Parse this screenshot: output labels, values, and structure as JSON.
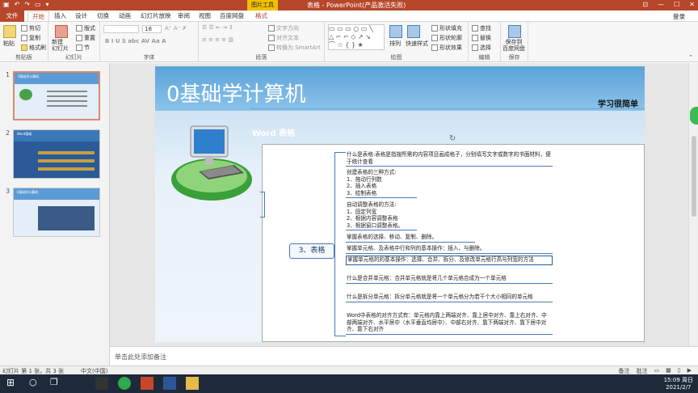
{
  "window": {
    "title": "表格 - PowerPoint(产品激活失败)",
    "context_tab": "图片工具",
    "login": "登录"
  },
  "tabs": [
    "文件",
    "开始",
    "插入",
    "设计",
    "切换",
    "动画",
    "幻灯片放映",
    "审阅",
    "视图",
    "百度网盘",
    "格式"
  ],
  "ribbon": {
    "clipboard": {
      "paste": "粘贴",
      "cut": "剪切",
      "copy": "复制",
      "format_painter": "格式刷",
      "label": "剪贴板"
    },
    "slides": {
      "new_slide": "新建\n幻灯片",
      "layout": "版式",
      "reset": "重置",
      "section": "节",
      "label": "幻灯片"
    },
    "font": {
      "size": "18",
      "label": "字体"
    },
    "paragraph": {
      "text_direction": "文字方向",
      "align_text": "对齐文本",
      "smartart": "转换为 SmartArt",
      "label": "段落"
    },
    "drawing": {
      "arrange": "排列",
      "quick_styles": "快速样式",
      "fill": "形状填充",
      "outline": "形状轮廓",
      "effects": "形状效果",
      "label": "绘图"
    },
    "editing": {
      "find": "查找",
      "replace": "替换",
      "select": "选择",
      "label": "编辑"
    },
    "save": {
      "save_baidu": "保存到\n百度网盘",
      "label": "保存"
    }
  },
  "slides_panel": [
    {
      "num": "1",
      "caption": "0基础学计算机"
    },
    {
      "num": "2",
      "caption": "Word基础"
    },
    {
      "num": "3",
      "caption": "0基础学计算机"
    }
  ],
  "slide": {
    "title": "0基础学计算机",
    "subtitle": "学习很简单",
    "word_title": "Word 表格",
    "node": "3、表格",
    "leaves": [
      "什么是表格:表格是指按所需的内容项目画成格子，分别填写文字或数字的书面材料，便于统计查看",
      "创建表格的三种方式:\n1、拖动行列数\n2、插入表格\n3、绘制表格",
      "自动调整表格的方法:\n1、固定列宽\n2、根据内容调整表格\n3、根据窗口调整表格。",
      "掌握表格的选择、移动、复制、删除。",
      "掌握单元格、及表格中行和列的基本操作：插入、与删除。",
      "掌握单元格的的基本操作：选择、合并、拆分、及修改单元格行高与列宽的方法",
      "什么是合并单元格：合并单元格就是将几个单元格合成为一个单元格",
      "什么是拆分单元格：拆分单元格就是将一个单元格分为若干个大小相同的单元格",
      "Word中表格的对齐方式有：单元格内靠上两端对齐、靠上居中对齐、靠上右对齐、中部两端对齐、水平居中（水平垂直均居中）、中部右对齐、靠下两端对齐、靠下居中对齐、靠下右对齐"
    ]
  },
  "notes_placeholder": "单击此处添加备注",
  "status": {
    "slide_info": "幻灯片 第 1 张，共 3 张",
    "language": "中文(中国)",
    "notes": "备注",
    "comments": "批注"
  },
  "tray": {
    "time": "15:09 周日",
    "date": "2021/2/7"
  },
  "colors": {
    "accent": "#b7472a",
    "slide_header": "#5aa3d8",
    "mind_border": "#4a79b3"
  }
}
